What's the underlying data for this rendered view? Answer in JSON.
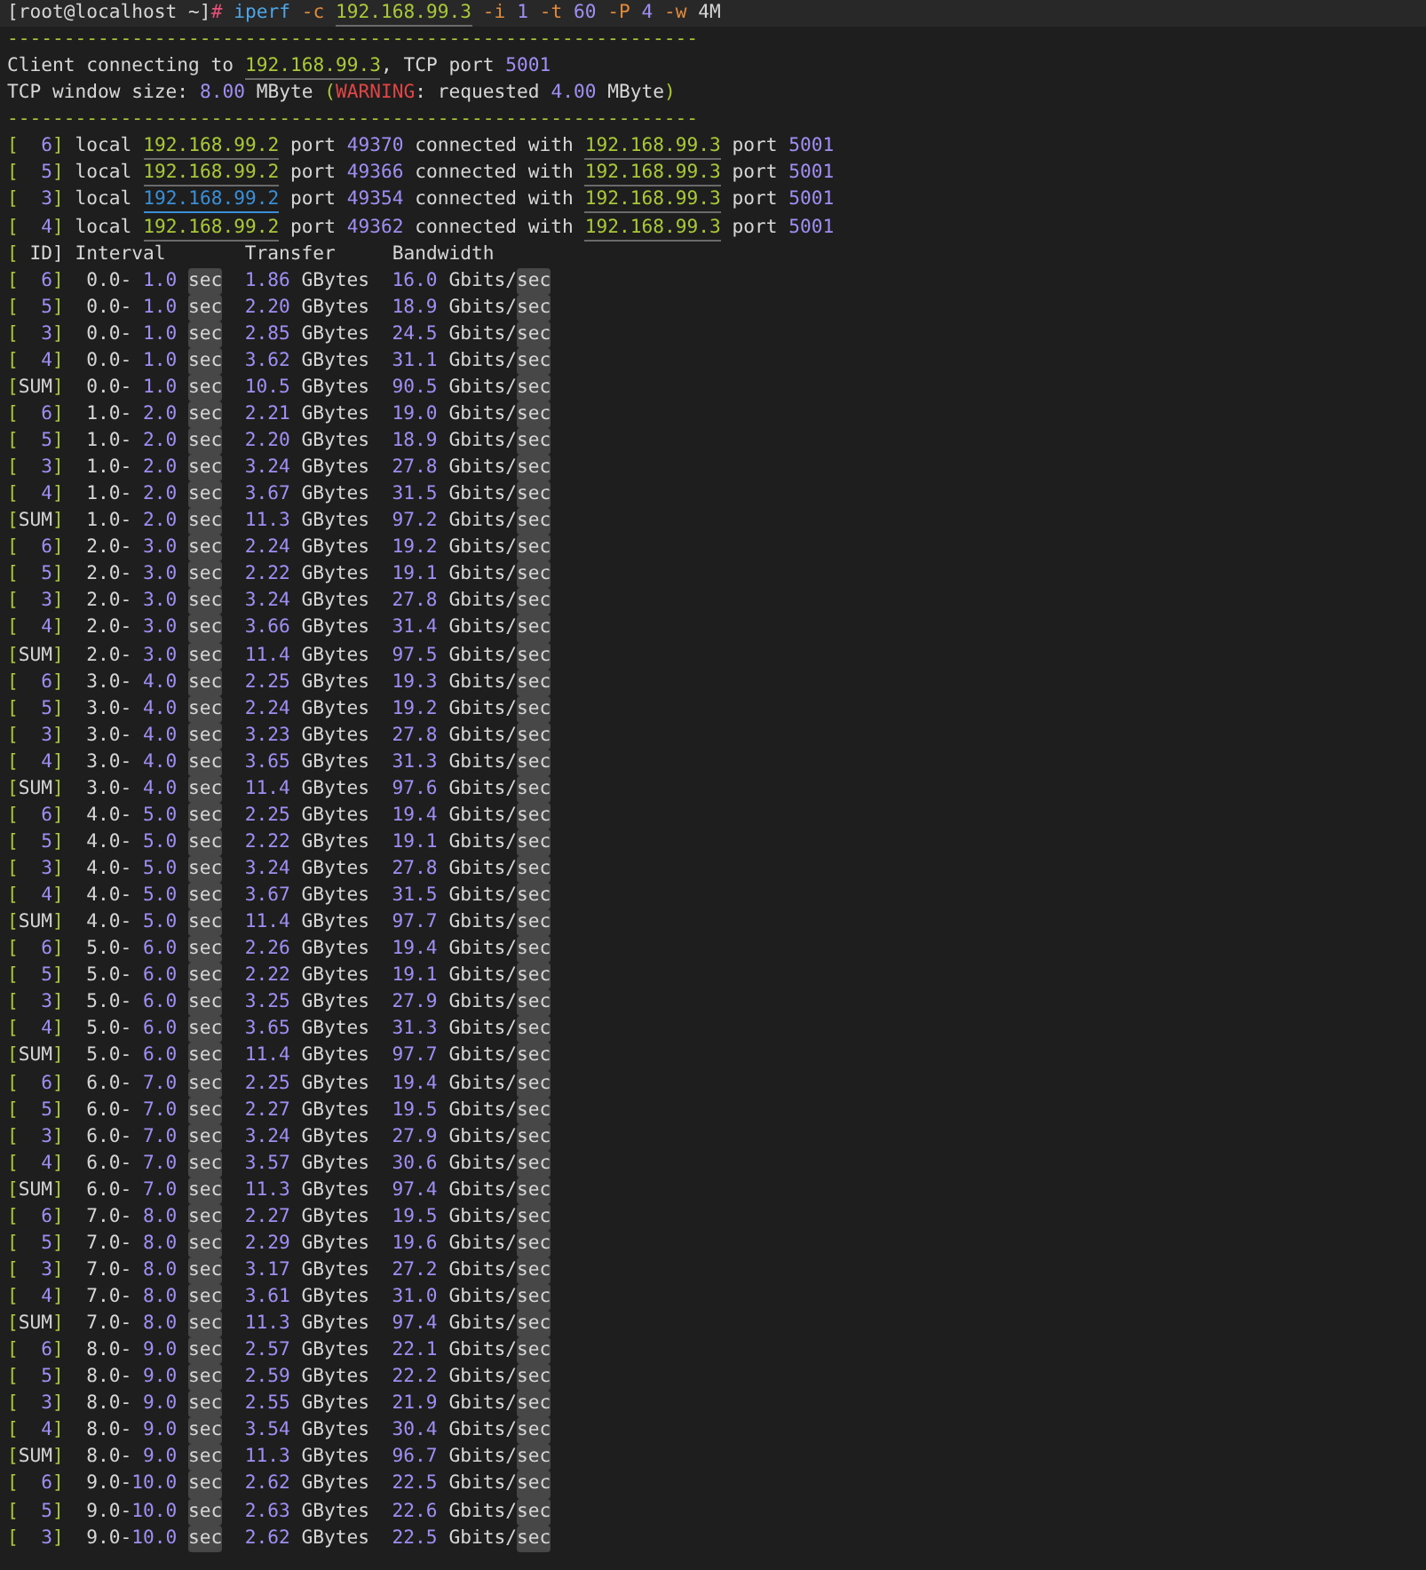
{
  "command_line": [
    {
      "kind": "prompt",
      "text": "[root@localhost ~]"
    },
    {
      "kind": "hash",
      "text": "#"
    },
    {
      "kind": "cmd",
      "text": " iperf"
    },
    {
      "kind": "flag",
      "text": " -c "
    },
    {
      "kind": "ip",
      "text": "192.168.99.3"
    },
    {
      "kind": "flag",
      "text": " -i"
    },
    {
      "kind": "num",
      "text": " 1"
    },
    {
      "kind": "flag",
      "text": " -t"
    },
    {
      "kind": "num",
      "text": " 60"
    },
    {
      "kind": "flag",
      "text": " -P"
    },
    {
      "kind": "num",
      "text": " 4"
    },
    {
      "kind": "flag",
      "text": " -w"
    },
    {
      "kind": "plain",
      "text": " 4M"
    }
  ],
  "separator_top": "-------------------------------------------------------------",
  "info_lines": [
    [
      {
        "kind": "plain",
        "text": "Client connecting to "
      },
      {
        "kind": "ip",
        "text": "192.168.99.3"
      },
      {
        "kind": "plain",
        "text": ", TCP port "
      },
      {
        "kind": "num",
        "text": "5001"
      }
    ],
    [
      {
        "kind": "plain",
        "text": "TCP window size: "
      },
      {
        "kind": "num",
        "text": "8.00"
      },
      {
        "kind": "plain",
        "text": " MByte "
      },
      {
        "kind": "paren",
        "text": "("
      },
      {
        "kind": "warn",
        "text": "WARNING"
      },
      {
        "kind": "plain",
        "text": ": requested "
      },
      {
        "kind": "num",
        "text": "4.00"
      },
      {
        "kind": "plain",
        "text": " MByte"
      },
      {
        "kind": "paren",
        "text": ")"
      }
    ]
  ],
  "separator_bottom": "-------------------------------------------------------------",
  "connections": [
    {
      "id": "[  6]",
      "local_label": "local",
      "local_ip": "192.168.99.2",
      "link_hovered": false,
      "port_label": "port",
      "local_port": "49370",
      "connected_label": "connected with",
      "remote_ip": "192.168.99.3",
      "remote_port_label": "port",
      "remote_port": "5001"
    },
    {
      "id": "[  5]",
      "local_label": "local",
      "local_ip": "192.168.99.2",
      "link_hovered": false,
      "port_label": "port",
      "local_port": "49366",
      "connected_label": "connected with",
      "remote_ip": "192.168.99.3",
      "remote_port_label": "port",
      "remote_port": "5001"
    },
    {
      "id": "[  3]",
      "local_label": "local",
      "local_ip": "192.168.99.2",
      "link_hovered": true,
      "port_label": "port",
      "local_port": "49354",
      "connected_label": "connected with",
      "remote_ip": "192.168.99.3",
      "remote_port_label": "port",
      "remote_port": "5001"
    },
    {
      "id": "[  4]",
      "local_label": "local",
      "local_ip": "192.168.99.2",
      "link_hovered": false,
      "port_label": "port",
      "local_port": "49362",
      "connected_label": "connected with",
      "remote_ip": "192.168.99.3",
      "remote_port_label": "port",
      "remote_port": "5001"
    }
  ],
  "columns": [
    "[ ID]",
    "Interval",
    "Transfer",
    "Bandwidth"
  ],
  "rows": [
    {
      "kind": "stream",
      "id": "[  6]",
      "interval": "0.0- 1.0",
      "unit": "sec",
      "transfer": "1.86",
      "transfer_unit": "GBytes",
      "bandwidth": "16.0",
      "bandwidth_unit": "Gbits/",
      "bandwidth_unit_tail": "sec"
    },
    {
      "kind": "stream",
      "id": "[  5]",
      "interval": "0.0- 1.0",
      "unit": "sec",
      "transfer": "2.20",
      "transfer_unit": "GBytes",
      "bandwidth": "18.9",
      "bandwidth_unit": "Gbits/",
      "bandwidth_unit_tail": "sec"
    },
    {
      "kind": "stream",
      "id": "[  3]",
      "interval": "0.0- 1.0",
      "unit": "sec",
      "transfer": "2.85",
      "transfer_unit": "GBytes",
      "bandwidth": "24.5",
      "bandwidth_unit": "Gbits/",
      "bandwidth_unit_tail": "sec"
    },
    {
      "kind": "stream",
      "id": "[  4]",
      "interval": "0.0- 1.0",
      "unit": "sec",
      "transfer": "3.62",
      "transfer_unit": "GBytes",
      "bandwidth": "31.1",
      "bandwidth_unit": "Gbits/",
      "bandwidth_unit_tail": "sec"
    },
    {
      "kind": "sum",
      "id": "[SUM]",
      "interval": "0.0- 1.0",
      "unit": "sec",
      "transfer": "10.5",
      "transfer_unit": "GBytes",
      "bandwidth": "90.5",
      "bandwidth_unit": "Gbits/",
      "bandwidth_unit_tail": "sec"
    },
    {
      "kind": "stream",
      "id": "[  6]",
      "interval": "1.0- 2.0",
      "unit": "sec",
      "transfer": "2.21",
      "transfer_unit": "GBytes",
      "bandwidth": "19.0",
      "bandwidth_unit": "Gbits/",
      "bandwidth_unit_tail": "sec"
    },
    {
      "kind": "stream",
      "id": "[  5]",
      "interval": "1.0- 2.0",
      "unit": "sec",
      "transfer": "2.20",
      "transfer_unit": "GBytes",
      "bandwidth": "18.9",
      "bandwidth_unit": "Gbits/",
      "bandwidth_unit_tail": "sec"
    },
    {
      "kind": "stream",
      "id": "[  3]",
      "interval": "1.0- 2.0",
      "unit": "sec",
      "transfer": "3.24",
      "transfer_unit": "GBytes",
      "bandwidth": "27.8",
      "bandwidth_unit": "Gbits/",
      "bandwidth_unit_tail": "sec"
    },
    {
      "kind": "stream",
      "id": "[  4]",
      "interval": "1.0- 2.0",
      "unit": "sec",
      "transfer": "3.67",
      "transfer_unit": "GBytes",
      "bandwidth": "31.5",
      "bandwidth_unit": "Gbits/",
      "bandwidth_unit_tail": "sec"
    },
    {
      "kind": "sum",
      "id": "[SUM]",
      "interval": "1.0- 2.0",
      "unit": "sec",
      "transfer": "11.3",
      "transfer_unit": "GBytes",
      "bandwidth": "97.2",
      "bandwidth_unit": "Gbits/",
      "bandwidth_unit_tail": "sec"
    },
    {
      "kind": "stream",
      "id": "[  6]",
      "interval": "2.0- 3.0",
      "unit": "sec",
      "transfer": "2.24",
      "transfer_unit": "GBytes",
      "bandwidth": "19.2",
      "bandwidth_unit": "Gbits/",
      "bandwidth_unit_tail": "sec"
    },
    {
      "kind": "stream",
      "id": "[  5]",
      "interval": "2.0- 3.0",
      "unit": "sec",
      "transfer": "2.22",
      "transfer_unit": "GBytes",
      "bandwidth": "19.1",
      "bandwidth_unit": "Gbits/",
      "bandwidth_unit_tail": "sec"
    },
    {
      "kind": "stream",
      "id": "[  3]",
      "interval": "2.0- 3.0",
      "unit": "sec",
      "transfer": "3.24",
      "transfer_unit": "GBytes",
      "bandwidth": "27.8",
      "bandwidth_unit": "Gbits/",
      "bandwidth_unit_tail": "sec"
    },
    {
      "kind": "stream",
      "id": "[  4]",
      "interval": "2.0- 3.0",
      "unit": "sec",
      "transfer": "3.66",
      "transfer_unit": "GBytes",
      "bandwidth": "31.4",
      "bandwidth_unit": "Gbits/",
      "bandwidth_unit_tail": "sec"
    },
    {
      "kind": "sum",
      "id": "[SUM]",
      "interval": "2.0- 3.0",
      "unit": "sec",
      "transfer": "11.4",
      "transfer_unit": "GBytes",
      "bandwidth": "97.5",
      "bandwidth_unit": "Gbits/",
      "bandwidth_unit_tail": "sec"
    },
    {
      "kind": "stream",
      "id": "[  6]",
      "interval": "3.0- 4.0",
      "unit": "sec",
      "transfer": "2.25",
      "transfer_unit": "GBytes",
      "bandwidth": "19.3",
      "bandwidth_unit": "Gbits/",
      "bandwidth_unit_tail": "sec"
    },
    {
      "kind": "stream",
      "id": "[  5]",
      "interval": "3.0- 4.0",
      "unit": "sec",
      "transfer": "2.24",
      "transfer_unit": "GBytes",
      "bandwidth": "19.2",
      "bandwidth_unit": "Gbits/",
      "bandwidth_unit_tail": "sec"
    },
    {
      "kind": "stream",
      "id": "[  3]",
      "interval": "3.0- 4.0",
      "unit": "sec",
      "transfer": "3.23",
      "transfer_unit": "GBytes",
      "bandwidth": "27.8",
      "bandwidth_unit": "Gbits/",
      "bandwidth_unit_tail": "sec"
    },
    {
      "kind": "stream",
      "id": "[  4]",
      "interval": "3.0- 4.0",
      "unit": "sec",
      "transfer": "3.65",
      "transfer_unit": "GBytes",
      "bandwidth": "31.3",
      "bandwidth_unit": "Gbits/",
      "bandwidth_unit_tail": "sec"
    },
    {
      "kind": "sum",
      "id": "[SUM]",
      "interval": "3.0- 4.0",
      "unit": "sec",
      "transfer": "11.4",
      "transfer_unit": "GBytes",
      "bandwidth": "97.6",
      "bandwidth_unit": "Gbits/",
      "bandwidth_unit_tail": "sec"
    },
    {
      "kind": "stream",
      "id": "[  6]",
      "interval": "4.0- 5.0",
      "unit": "sec",
      "transfer": "2.25",
      "transfer_unit": "GBytes",
      "bandwidth": "19.4",
      "bandwidth_unit": "Gbits/",
      "bandwidth_unit_tail": "sec"
    },
    {
      "kind": "stream",
      "id": "[  5]",
      "interval": "4.0- 5.0",
      "unit": "sec",
      "transfer": "2.22",
      "transfer_unit": "GBytes",
      "bandwidth": "19.1",
      "bandwidth_unit": "Gbits/",
      "bandwidth_unit_tail": "sec"
    },
    {
      "kind": "stream",
      "id": "[  3]",
      "interval": "4.0- 5.0",
      "unit": "sec",
      "transfer": "3.24",
      "transfer_unit": "GBytes",
      "bandwidth": "27.8",
      "bandwidth_unit": "Gbits/",
      "bandwidth_unit_tail": "sec"
    },
    {
      "kind": "stream",
      "id": "[  4]",
      "interval": "4.0- 5.0",
      "unit": "sec",
      "transfer": "3.67",
      "transfer_unit": "GBytes",
      "bandwidth": "31.5",
      "bandwidth_unit": "Gbits/",
      "bandwidth_unit_tail": "sec"
    },
    {
      "kind": "sum",
      "id": "[SUM]",
      "interval": "4.0- 5.0",
      "unit": "sec",
      "transfer": "11.4",
      "transfer_unit": "GBytes",
      "bandwidth": "97.7",
      "bandwidth_unit": "Gbits/",
      "bandwidth_unit_tail": "sec"
    },
    {
      "kind": "stream",
      "id": "[  6]",
      "interval": "5.0- 6.0",
      "unit": "sec",
      "transfer": "2.26",
      "transfer_unit": "GBytes",
      "bandwidth": "19.4",
      "bandwidth_unit": "Gbits/",
      "bandwidth_unit_tail": "sec"
    },
    {
      "kind": "stream",
      "id": "[  5]",
      "interval": "5.0- 6.0",
      "unit": "sec",
      "transfer": "2.22",
      "transfer_unit": "GBytes",
      "bandwidth": "19.1",
      "bandwidth_unit": "Gbits/",
      "bandwidth_unit_tail": "sec"
    },
    {
      "kind": "stream",
      "id": "[  3]",
      "interval": "5.0- 6.0",
      "unit": "sec",
      "transfer": "3.25",
      "transfer_unit": "GBytes",
      "bandwidth": "27.9",
      "bandwidth_unit": "Gbits/",
      "bandwidth_unit_tail": "sec"
    },
    {
      "kind": "stream",
      "id": "[  4]",
      "interval": "5.0- 6.0",
      "unit": "sec",
      "transfer": "3.65",
      "transfer_unit": "GBytes",
      "bandwidth": "31.3",
      "bandwidth_unit": "Gbits/",
      "bandwidth_unit_tail": "sec"
    },
    {
      "kind": "sum",
      "id": "[SUM]",
      "interval": "5.0- 6.0",
      "unit": "sec",
      "transfer": "11.4",
      "transfer_unit": "GBytes",
      "bandwidth": "97.7",
      "bandwidth_unit": "Gbits/",
      "bandwidth_unit_tail": "sec"
    },
    {
      "kind": "stream",
      "id": "[  6]",
      "interval": "6.0- 7.0",
      "unit": "sec",
      "transfer": "2.25",
      "transfer_unit": "GBytes",
      "bandwidth": "19.4",
      "bandwidth_unit": "Gbits/",
      "bandwidth_unit_tail": "sec"
    },
    {
      "kind": "stream",
      "id": "[  5]",
      "interval": "6.0- 7.0",
      "unit": "sec",
      "transfer": "2.27",
      "transfer_unit": "GBytes",
      "bandwidth": "19.5",
      "bandwidth_unit": "Gbits/",
      "bandwidth_unit_tail": "sec"
    },
    {
      "kind": "stream",
      "id": "[  3]",
      "interval": "6.0- 7.0",
      "unit": "sec",
      "transfer": "3.24",
      "transfer_unit": "GBytes",
      "bandwidth": "27.9",
      "bandwidth_unit": "Gbits/",
      "bandwidth_unit_tail": "sec"
    },
    {
      "kind": "stream",
      "id": "[  4]",
      "interval": "6.0- 7.0",
      "unit": "sec",
      "transfer": "3.57",
      "transfer_unit": "GBytes",
      "bandwidth": "30.6",
      "bandwidth_unit": "Gbits/",
      "bandwidth_unit_tail": "sec"
    },
    {
      "kind": "sum",
      "id": "[SUM]",
      "interval": "6.0- 7.0",
      "unit": "sec",
      "transfer": "11.3",
      "transfer_unit": "GBytes",
      "bandwidth": "97.4",
      "bandwidth_unit": "Gbits/",
      "bandwidth_unit_tail": "sec"
    },
    {
      "kind": "stream",
      "id": "[  6]",
      "interval": "7.0- 8.0",
      "unit": "sec",
      "transfer": "2.27",
      "transfer_unit": "GBytes",
      "bandwidth": "19.5",
      "bandwidth_unit": "Gbits/",
      "bandwidth_unit_tail": "sec"
    },
    {
      "kind": "stream",
      "id": "[  5]",
      "interval": "7.0- 8.0",
      "unit": "sec",
      "transfer": "2.29",
      "transfer_unit": "GBytes",
      "bandwidth": "19.6",
      "bandwidth_unit": "Gbits/",
      "bandwidth_unit_tail": "sec"
    },
    {
      "kind": "stream",
      "id": "[  3]",
      "interval": "7.0- 8.0",
      "unit": "sec",
      "transfer": "3.17",
      "transfer_unit": "GBytes",
      "bandwidth": "27.2",
      "bandwidth_unit": "Gbits/",
      "bandwidth_unit_tail": "sec"
    },
    {
      "kind": "stream",
      "id": "[  4]",
      "interval": "7.0- 8.0",
      "unit": "sec",
      "transfer": "3.61",
      "transfer_unit": "GBytes",
      "bandwidth": "31.0",
      "bandwidth_unit": "Gbits/",
      "bandwidth_unit_tail": "sec"
    },
    {
      "kind": "sum",
      "id": "[SUM]",
      "interval": "7.0- 8.0",
      "unit": "sec",
      "transfer": "11.3",
      "transfer_unit": "GBytes",
      "bandwidth": "97.4",
      "bandwidth_unit": "Gbits/",
      "bandwidth_unit_tail": "sec"
    },
    {
      "kind": "stream",
      "id": "[  6]",
      "interval": "8.0- 9.0",
      "unit": "sec",
      "transfer": "2.57",
      "transfer_unit": "GBytes",
      "bandwidth": "22.1",
      "bandwidth_unit": "Gbits/",
      "bandwidth_unit_tail": "sec"
    },
    {
      "kind": "stream",
      "id": "[  5]",
      "interval": "8.0- 9.0",
      "unit": "sec",
      "transfer": "2.59",
      "transfer_unit": "GBytes",
      "bandwidth": "22.2",
      "bandwidth_unit": "Gbits/",
      "bandwidth_unit_tail": "sec"
    },
    {
      "kind": "stream",
      "id": "[  3]",
      "interval": "8.0- 9.0",
      "unit": "sec",
      "transfer": "2.55",
      "transfer_unit": "GBytes",
      "bandwidth": "21.9",
      "bandwidth_unit": "Gbits/",
      "bandwidth_unit_tail": "sec"
    },
    {
      "kind": "stream",
      "id": "[  4]",
      "interval": "8.0- 9.0",
      "unit": "sec",
      "transfer": "3.54",
      "transfer_unit": "GBytes",
      "bandwidth": "30.4",
      "bandwidth_unit": "Gbits/",
      "bandwidth_unit_tail": "sec"
    },
    {
      "kind": "sum",
      "id": "[SUM]",
      "interval": "8.0- 9.0",
      "unit": "sec",
      "transfer": "11.3",
      "transfer_unit": "GBytes",
      "bandwidth": "96.7",
      "bandwidth_unit": "Gbits/",
      "bandwidth_unit_tail": "sec"
    },
    {
      "kind": "stream",
      "id": "[  6]",
      "interval": "9.0-10.0",
      "unit": "sec",
      "transfer": "2.62",
      "transfer_unit": "GBytes",
      "bandwidth": "22.5",
      "bandwidth_unit": "Gbits/",
      "bandwidth_unit_tail": "sec"
    },
    {
      "kind": "stream",
      "id": "[  5]",
      "interval": "9.0-10.0",
      "unit": "sec",
      "transfer": "2.63",
      "transfer_unit": "GBytes",
      "bandwidth": "22.6",
      "bandwidth_unit": "Gbits/",
      "bandwidth_unit_tail": "sec"
    },
    {
      "kind": "stream",
      "id": "[  3]",
      "interval": "9.0-10.0",
      "unit": "sec",
      "transfer": "2.62",
      "transfer_unit": "GBytes",
      "bandwidth": "22.5",
      "bandwidth_unit": "Gbits/",
      "bandwidth_unit_tail": "sec"
    }
  ]
}
